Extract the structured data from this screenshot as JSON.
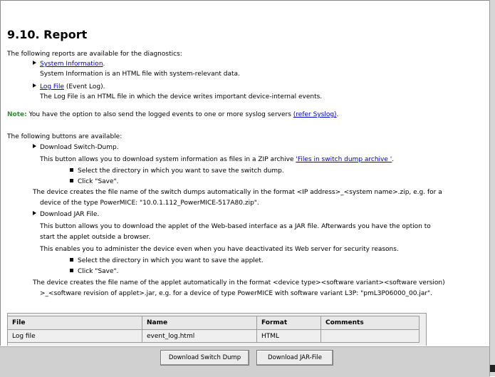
{
  "heading": "9.10. Report",
  "intro": "The following reports are available for the diagnostics:",
  "reports": [
    {
      "link": "System Information",
      "link_suffix": ".",
      "desc": "System Information is an HTML file with system-relevant data."
    },
    {
      "link": "Log File",
      "link_suffix": " (Event Log).",
      "desc": "The Log File is an HTML file in which the device writes important device-internal events."
    }
  ],
  "note": {
    "label": "Note:",
    "text": "You have the option to also send the logged events to one or more syslog servers",
    "link": "(refer Syslog)",
    "suffix": "."
  },
  "buttons_intro": "The following buttons are available:",
  "switch_dump": {
    "title": "Download Switch-Dump.",
    "desc_prefix": "This button allows you to download system information as files in a ZIP archive",
    "desc_link": "'Files in switch dump archive '",
    "desc_suffix": ".",
    "step1": "Select the directory in which you want to save the switch dump.",
    "step2": "Click \"Save\".",
    "filename_line1": "The device creates the file name of the switch dumps automatically in the format <IP address>_<system name>.zip, e.g. for a",
    "filename_line2": "device of the type PowerMICE: \"10.0.1.112_PowerMICE-517A80.zip\"."
  },
  "jar_file": {
    "title": "Download JAR File.",
    "desc_line1": "This button allows you to download the applet of the Web-based interface as a JAR file. Afterwards you have the option to",
    "desc_line2": "start the applet outside a browser.",
    "desc_line3": "This enables you to administer the device even when you have deactivated its Web server for security reasons.",
    "step1": "Select the directory in which you want to save the applet.",
    "step2": "Click \"Save\".",
    "filename_line1": "The device creates the file name of the applet automatically in the format <device type><software variant><software version)",
    "filename_line2": ">_<software revision of applet>.jar, e.g. for a device of type PowerMICE with software variant L3P: \"pmL3P06000_00.jar\"."
  },
  "table": {
    "headers": [
      "File",
      "Name",
      "Format",
      "Comments"
    ],
    "rows": [
      [
        "Log file",
        "event_log.html",
        "HTML",
        ""
      ]
    ]
  },
  "bottom_buttons": {
    "switch_dump": "Download Switch Dump",
    "jar_file": "Download JAR-File"
  }
}
